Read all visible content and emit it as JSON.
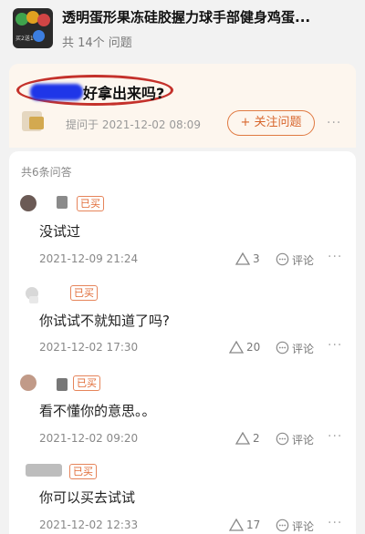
{
  "product": {
    "title": "透明蛋形果冻硅胶握力球手部健身鸡蛋...",
    "question_count": "共 14个 问题",
    "thumb_text": "买2送1"
  },
  "question": {
    "title": "好拿出来吗?",
    "asked_meta": "提问于 2021-12-02 08:09",
    "follow_label": "+ 关注问题",
    "more": "···"
  },
  "answers_header": "共6条问答",
  "answers": [
    {
      "badge": "已买",
      "text": "没试过",
      "date": "2021-12-09 21:24",
      "likes": "3",
      "comment_label": "评论",
      "more": "···"
    },
    {
      "badge": "已买",
      "text": "你试试不就知道了吗?",
      "date": "2021-12-02 17:30",
      "likes": "20",
      "comment_label": "评论",
      "more": "···"
    },
    {
      "badge": "已买",
      "text": "看不懂你的意思。。",
      "date": "2021-12-02 09:20",
      "likes": "2",
      "comment_label": "评论",
      "more": "···"
    },
    {
      "badge": "已买",
      "text": "你可以买去试试",
      "date": "2021-12-02 12:33",
      "likes": "17",
      "comment_label": "评论",
      "more": "···"
    }
  ],
  "colors": {
    "accent": "#e07a42",
    "highlight_circle": "#c4312b",
    "question_bg": "#fdf6ee"
  }
}
